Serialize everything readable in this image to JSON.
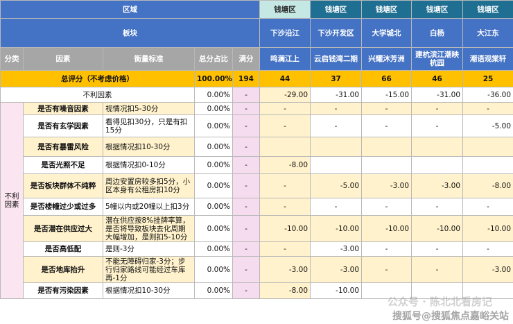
{
  "header": {
    "region_label": "区域",
    "sector_label": "板块",
    "col_category": "分类",
    "col_factor": "因素",
    "col_standard": "衡量标准",
    "col_share": "总分占比",
    "col_full": "满分",
    "regions": [
      "钱塘区",
      "钱塘区",
      "钱塘区",
      "钱塘区",
      "钱塘区"
    ],
    "sectors": [
      "下沙沿江",
      "下沙开发区",
      "大学城北",
      "白杨",
      "大江东"
    ],
    "projects": [
      "鸣澜江上",
      "云启钱湾二期",
      "兴耀沐芳洲",
      "建杭滨江潮映杭园",
      "潮语观棠轩"
    ]
  },
  "total_row": {
    "label": "总评分（不考虑价格）",
    "share": "100.00%",
    "full": "194",
    "scores": [
      "44",
      "37",
      "66",
      "46",
      "25"
    ]
  },
  "negative_row": {
    "label": "不利因素",
    "share": "0.00%",
    "full": "-",
    "scores": [
      "-29.00",
      "-31.00",
      "-15.00",
      "-31.00",
      "-36.00"
    ]
  },
  "category_label": "不利因素",
  "rows": [
    {
      "factor": "是否有噪音因素",
      "standard": "视情况扣5-30分",
      "share": "0.00%",
      "full": "-",
      "scores": [
        "-",
        "-",
        "-",
        "-",
        "-"
      ]
    },
    {
      "factor": "是否有玄学因素",
      "standard": "看得见扣30分，只是有扣15分",
      "share": "0.00%",
      "full": "-",
      "scores": [
        "-",
        "-",
        "-",
        "-",
        "-5.00"
      ]
    },
    {
      "factor": "是否有暴雷风险",
      "standard": "根据情况扣10-30分",
      "share": "0.00%",
      "full": "-",
      "scores": [
        "",
        "",
        "",
        "",
        ""
      ]
    },
    {
      "factor": "是否光照不足",
      "standard": "根据情况扣0-10分",
      "share": "0.00%",
      "full": "-",
      "scores": [
        "-8.00",
        "",
        "",
        "",
        ""
      ]
    },
    {
      "factor": "是否板块群体不纯粹",
      "standard": "周边安置房较多扣5分，小区本身有公租房扣10分",
      "share": "0.00%",
      "full": "-",
      "scores": [
        "-",
        "-5.00",
        "-3.00",
        "-3.00",
        "-8.00"
      ]
    },
    {
      "factor": "是否楼幢过少或过多",
      "standard": "5幢以内或20幢以上扣3分",
      "share": "0.00%",
      "full": "-",
      "scores": [
        "-",
        "-",
        "-",
        "-",
        "-"
      ]
    },
    {
      "factor": "是否潜在供应过大",
      "standard": "潜在供应按8%挂牌率算，是否将导致板块去化周期大幅增加，是则扣5-10分",
      "share": "0.00%",
      "full": "-",
      "scores": [
        "-10.00",
        "-10.00",
        "-10.00",
        "-10.00",
        "-10.00"
      ]
    },
    {
      "factor": "是否高低配",
      "standard": "是则-3分",
      "share": "0.00%",
      "full": "-",
      "scores": [
        "-",
        "-3.00",
        "-",
        "-",
        "-"
      ]
    },
    {
      "factor": "是否地库抬升",
      "standard": "不能无障碍归家-3分；步行归家路线可能经过车库再-1分",
      "share": "0.00%",
      "full": "-",
      "scores": [
        "-3.00",
        "-3.00",
        "-",
        "-",
        "-3.00"
      ]
    },
    {
      "factor": "是否有污染因素",
      "standard": "根据情况扣10-30分",
      "share": "0.00%",
      "full": "-",
      "scores": [
        "-8.00",
        "-10.00",
        "",
        "",
        ""
      ]
    }
  ],
  "watermarks": {
    "wechat": "公众号 · 陈北北看房记",
    "sohu": "搜狐号@搜狐焦点嘉峪关站"
  }
}
